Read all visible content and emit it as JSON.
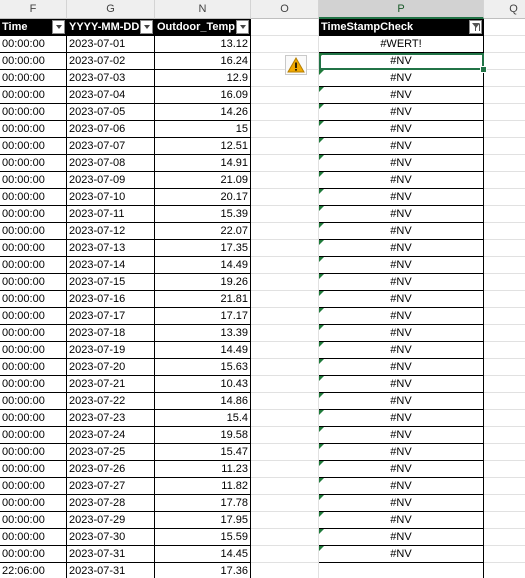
{
  "columns": [
    {
      "letter": "F",
      "header": "Time"
    },
    {
      "letter": "G",
      "header": "YYYY-MM-DD"
    },
    {
      "letter": "N",
      "header": "Outdoor_Temp"
    },
    {
      "letter": "O",
      "header": ""
    },
    {
      "letter": "P",
      "header": "TimeStampCheck"
    },
    {
      "letter": "Q",
      "header": ""
    }
  ],
  "selected_column": "P",
  "rows": [
    {
      "time": "00:00:00",
      "date": "2023-07-01",
      "temp": "13.12",
      "check": "#WERT!"
    },
    {
      "time": "00:00:00",
      "date": "2023-07-02",
      "temp": "16.24",
      "check": "#NV"
    },
    {
      "time": "00:00:00",
      "date": "2023-07-03",
      "temp": "12.9",
      "check": "#NV"
    },
    {
      "time": "00:00:00",
      "date": "2023-07-04",
      "temp": "16.09",
      "check": "#NV"
    },
    {
      "time": "00:00:00",
      "date": "2023-07-05",
      "temp": "14.26",
      "check": "#NV"
    },
    {
      "time": "00:00:00",
      "date": "2023-07-06",
      "temp": "15",
      "check": "#NV"
    },
    {
      "time": "00:00:00",
      "date": "2023-07-07",
      "temp": "12.51",
      "check": "#NV"
    },
    {
      "time": "00:00:00",
      "date": "2023-07-08",
      "temp": "14.91",
      "check": "#NV"
    },
    {
      "time": "00:00:00",
      "date": "2023-07-09",
      "temp": "21.09",
      "check": "#NV"
    },
    {
      "time": "00:00:00",
      "date": "2023-07-10",
      "temp": "20.17",
      "check": "#NV"
    },
    {
      "time": "00:00:00",
      "date": "2023-07-11",
      "temp": "15.39",
      "check": "#NV"
    },
    {
      "time": "00:00:00",
      "date": "2023-07-12",
      "temp": "22.07",
      "check": "#NV"
    },
    {
      "time": "00:00:00",
      "date": "2023-07-13",
      "temp": "17.35",
      "check": "#NV"
    },
    {
      "time": "00:00:00",
      "date": "2023-07-14",
      "temp": "14.49",
      "check": "#NV"
    },
    {
      "time": "00:00:00",
      "date": "2023-07-15",
      "temp": "19.26",
      "check": "#NV"
    },
    {
      "time": "00:00:00",
      "date": "2023-07-16",
      "temp": "21.81",
      "check": "#NV"
    },
    {
      "time": "00:00:00",
      "date": "2023-07-17",
      "temp": "17.17",
      "check": "#NV"
    },
    {
      "time": "00:00:00",
      "date": "2023-07-18",
      "temp": "13.39",
      "check": "#NV"
    },
    {
      "time": "00:00:00",
      "date": "2023-07-19",
      "temp": "14.49",
      "check": "#NV"
    },
    {
      "time": "00:00:00",
      "date": "2023-07-20",
      "temp": "15.63",
      "check": "#NV"
    },
    {
      "time": "00:00:00",
      "date": "2023-07-21",
      "temp": "10.43",
      "check": "#NV"
    },
    {
      "time": "00:00:00",
      "date": "2023-07-22",
      "temp": "14.86",
      "check": "#NV"
    },
    {
      "time": "00:00:00",
      "date": "2023-07-23",
      "temp": "15.4",
      "check": "#NV"
    },
    {
      "time": "00:00:00",
      "date": "2023-07-24",
      "temp": "19.58",
      "check": "#NV"
    },
    {
      "time": "00:00:00",
      "date": "2023-07-25",
      "temp": "15.47",
      "check": "#NV"
    },
    {
      "time": "00:00:00",
      "date": "2023-07-26",
      "temp": "11.23",
      "check": "#NV"
    },
    {
      "time": "00:00:00",
      "date": "2023-07-27",
      "temp": "11.82",
      "check": "#NV"
    },
    {
      "time": "00:00:00",
      "date": "2023-07-28",
      "temp": "17.78",
      "check": "#NV"
    },
    {
      "time": "00:00:00",
      "date": "2023-07-29",
      "temp": "17.95",
      "check": "#NV"
    },
    {
      "time": "00:00:00",
      "date": "2023-07-30",
      "temp": "15.59",
      "check": "#NV"
    },
    {
      "time": "00:00:00",
      "date": "2023-07-31",
      "temp": "14.45",
      "check": "#NV"
    },
    {
      "time": "22:06:00",
      "date": "2023-07-31",
      "temp": "17.36",
      "check": ""
    }
  ],
  "icons": {
    "error_indicator": "warning-triangle-icon",
    "autofilter": "dropdown-arrow-icon",
    "filter_active": "filter-icon"
  },
  "colors": {
    "header_fill": "#000000",
    "header_text": "#ffffff",
    "selection": "#217346",
    "error_triangle": "#1f7a3a",
    "warning": "#f2a900"
  }
}
